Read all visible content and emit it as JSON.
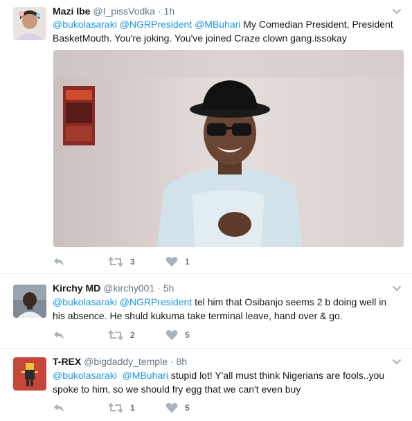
{
  "tweets": [
    {
      "name": "Mazi Ibe",
      "handle": "@I_pissVodka",
      "separator": "·",
      "time": "1h",
      "text": {
        "line1_mentions": [
          "@bukolasaraki",
          "@NGRPresident",
          "@MBuhari"
        ],
        "line1_rest": "My Comedian President, President",
        "line2": "BasketMouth. You're joking. You've joined Craze clown gang.issokay"
      },
      "has_media": true,
      "retweets": "3",
      "likes": "1"
    },
    {
      "name": "Kirchy MD",
      "handle": "@kirchy001",
      "separator": "·",
      "time": "5h",
      "text": {
        "line1_mentions": [
          "@bukolasaraki",
          "@NGRPresident"
        ],
        "line1_rest": "tel him that Osibanjo seems 2 b doing well in",
        "line2": "his absence. He shuld kukuma take terminal leave, hand over & go."
      },
      "has_media": false,
      "retweets": "2",
      "likes": "5"
    },
    {
      "name": "T-REX",
      "handle": "@bigdaddy_temple",
      "separator": "·",
      "time": "8h",
      "text": {
        "line1_mentions": [
          "@bukolasaraki",
          "@MBuhari"
        ],
        "line1_rest": "stupid lot! Y'all must think Nigerians are fools..you",
        "line2": "spoke to him, so we should fry egg that we can't even buy"
      },
      "has_media": false,
      "retweets": "1",
      "likes": "5"
    }
  ],
  "icons": {
    "reply": "reply-icon",
    "retweet": "retweet-icon",
    "like": "heart-icon",
    "more": "chevron-down-icon"
  },
  "colors": {
    "mention": "#1b95e0",
    "muted": "#657786",
    "divider": "#e6ecf0",
    "text": "#14171a"
  }
}
